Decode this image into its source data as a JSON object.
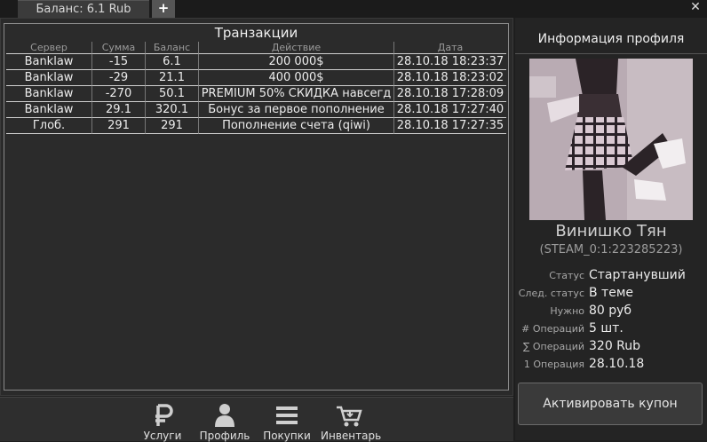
{
  "tabs": {
    "balance": "Баланс: 6.1 Rub",
    "add": "+"
  },
  "window": {
    "close": "✕"
  },
  "transactions": {
    "title": "Транзакции",
    "columns": [
      "Сервер",
      "Сумма",
      "Баланс",
      "Действие",
      "Дата"
    ],
    "rows": [
      [
        "Banklaw",
        "-15",
        "6.1",
        "200 000$",
        "28.10.18 18:23:37"
      ],
      [
        "Banklaw",
        "-29",
        "21.1",
        "400 000$",
        "28.10.18 18:23:02"
      ],
      [
        "Banklaw",
        "-270",
        "50.1",
        "PREMIUM 50% СКИДКА навсегд",
        "28.10.18 17:28:09"
      ],
      [
        "Banklaw",
        "29.1",
        "320.1",
        "Бонус за первое пополнение",
        "28.10.18 17:27:40"
      ],
      [
        "Глоб.",
        "291",
        "291",
        "Пополнение счета (qiwi)",
        "28.10.18 17:27:35"
      ]
    ]
  },
  "nav": [
    {
      "label": "Услуги",
      "icon": "ruble-icon"
    },
    {
      "label": "Профиль",
      "icon": "user-icon"
    },
    {
      "label": "Покупки",
      "icon": "list-icon"
    },
    {
      "label": "Инвентарь",
      "icon": "cart-icon"
    }
  ],
  "profile": {
    "title": "Информация профиля",
    "name": "Винишко Тян",
    "steam_id": "(STEAM_0:1:223285223)",
    "info": [
      {
        "label": "Статус",
        "value": "Стартанувший"
      },
      {
        "label": "След. статус",
        "value": "В теме"
      },
      {
        "label": "Нужно",
        "value": "80 руб"
      },
      {
        "label": "# Операций",
        "value": "5 шт."
      },
      {
        "label": "∑ Операций",
        "value": "320 Rub"
      },
      {
        "label": "1 Операция",
        "value": "28.10.18"
      }
    ],
    "coupon_button": "Активировать купон"
  },
  "colors": {
    "background": "#1e1e1e",
    "panel": "#2a2a2a",
    "border": "#8a8a8a",
    "text": "#e6e6e6"
  }
}
